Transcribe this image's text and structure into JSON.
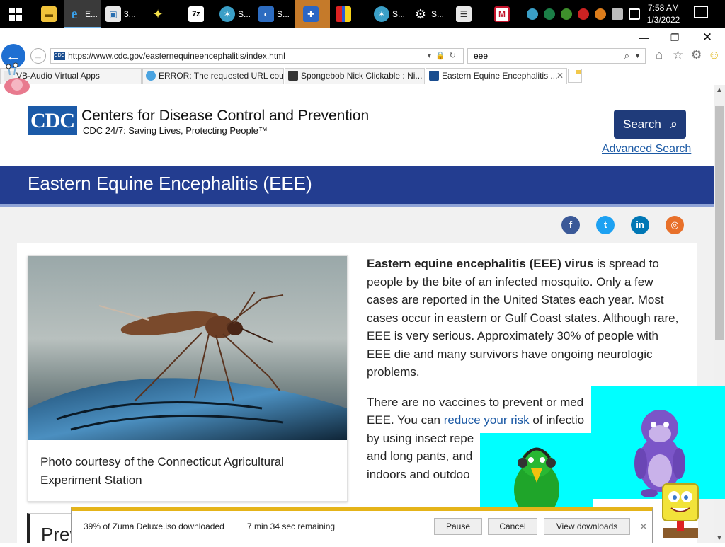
{
  "taskbar": {
    "items": [
      {
        "label": "E..."
      },
      {
        "label": "3..."
      },
      {
        "label": "S..."
      },
      {
        "label": "S..."
      },
      {
        "label": "S..."
      },
      {
        "label": "S..."
      }
    ],
    "clock_time": "7:58 AM",
    "clock_date": "1/3/2022"
  },
  "browser": {
    "url": "https://www.cdc.gov/easternequineencephalitis/index.html",
    "search_query": "eee",
    "tabs": [
      {
        "label": "VB-Audio Virtual Apps"
      },
      {
        "label": "ERROR: The requested URL cou..."
      },
      {
        "label": "Spongebob Nick Clickable : Ni..."
      },
      {
        "label": "Eastern Equine Encephalitis ..."
      }
    ]
  },
  "header": {
    "logo_text": "CDC",
    "org_name": "Centers for Disease Control and Prevention",
    "tagline": "CDC 24/7: Saving Lives, Protecting People™",
    "search_button": "Search",
    "advanced_search": "Advanced Search"
  },
  "banner": {
    "title": "Eastern Equine Encephalitis (EEE)"
  },
  "content": {
    "caption": "Photo courtesy of the Connecticut Agricultural Experiment Station",
    "p1_bold": "Eastern equine encephalitis (EEE) virus",
    "p1_rest": " is spread to people by the bite of an infected mosquito. Only a few cases are reported in the United States each year. Most cases occur in eastern or Gulf Coast states. Although rare, EEE is very serious. Approximately 30% of people with EEE die and many survivors have ongoing neurologic problems.",
    "p2_start": "There are no vaccines to prevent or med",
    "p2_line2_start": "EEE. You can ",
    "p2_link": "reduce your risk",
    "p2_after_link": " of infectio",
    "p2_line3": "by using insect repe",
    "p2_line4": "and long pants, and",
    "p2_line5": "indoors and outdoo",
    "prev_box": "Prev"
  },
  "download": {
    "message": "39% of Zuma Deluxe.iso downloaded",
    "time_remaining": "7 min 34 sec remaining",
    "pause": "Pause",
    "cancel": "Cancel",
    "view": "View downloads"
  },
  "colors": {
    "banner": "#233d90",
    "search_button": "#1f3b7a",
    "link": "#1c5aa5",
    "download_accent": "#e5b419",
    "overlay_cyan": "#00ffff"
  }
}
